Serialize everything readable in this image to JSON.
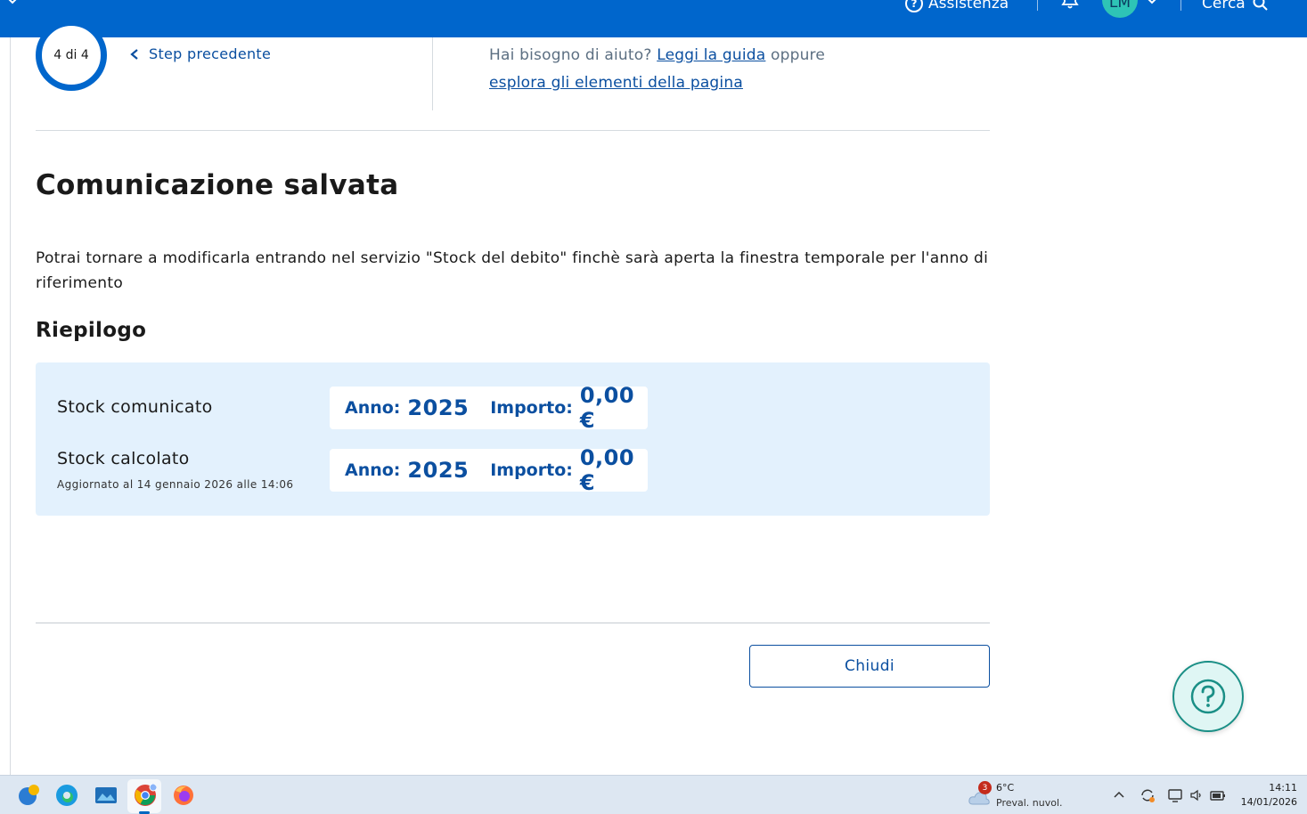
{
  "header": {
    "assistance_label": "Assistenza",
    "avatar_initials": "LM",
    "search_label": "Cerca",
    "brand_color": "#0066cc"
  },
  "stepper": {
    "progress_text": "4 di 4",
    "current_step": 4,
    "total_steps": 4,
    "prev_step_label": "Step precedente"
  },
  "help": {
    "prefix": "Hai bisogno di aiuto?",
    "guide_link": "Leggi la guida",
    "middle": "oppure",
    "explore_link": "esplora gli elementi della pagina"
  },
  "main": {
    "title": "Comunicazione salvata",
    "description": "Potrai tornare a modificarla entrando nel servizio \"Stock del debito\" finchè sarà aperta la finestra temporale per l'anno di riferimento",
    "summary_title": "Riepilogo"
  },
  "summary": {
    "rows": [
      {
        "label": "Stock comunicato",
        "sublabel": "",
        "year_key": "Anno:",
        "year": "2025",
        "amount_key": "Importo:",
        "amount": "0,00 €"
      },
      {
        "label": "Stock calcolato",
        "sublabel": "Aggiornato al 14 gennaio 2026 alle 14:06",
        "year_key": "Anno:",
        "year": "2025",
        "amount_key": "Importo:",
        "amount": "0,00 €"
      }
    ]
  },
  "actions": {
    "close_label": "Chiudi"
  },
  "fab": {
    "icon": "question-mark-icon"
  },
  "taskbar": {
    "weather_badge": "3",
    "weather_temp": "6°C",
    "weather_condition": "Preval. nuvol.",
    "time": "14:11",
    "date": "14/01/2026"
  }
}
